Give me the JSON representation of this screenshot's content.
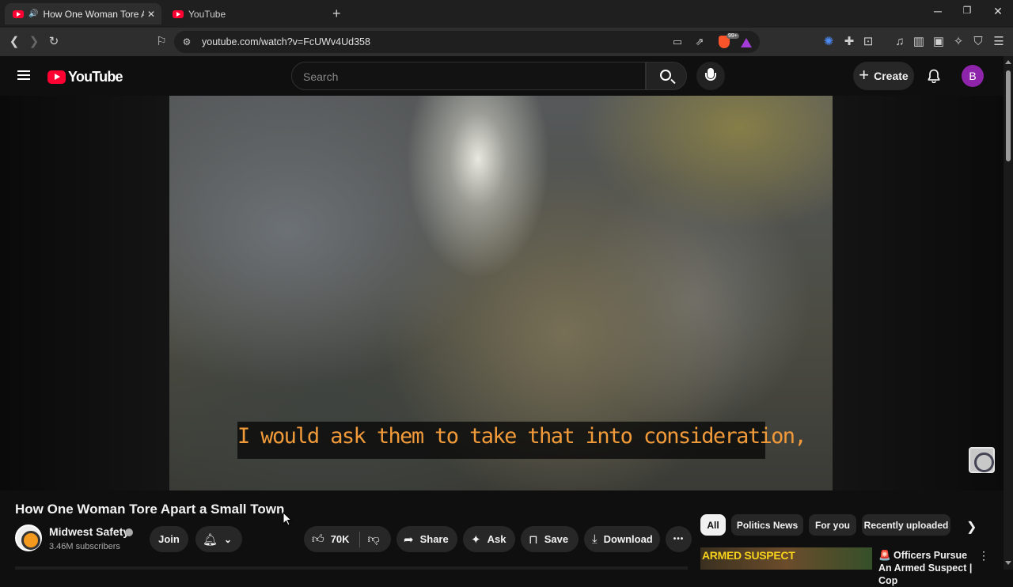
{
  "browser": {
    "tabs": [
      {
        "title": "How One Woman Tore Apart",
        "playing_audio": true,
        "active": true
      },
      {
        "title": "YouTube",
        "active": false
      }
    ],
    "new_tab": "+",
    "window": {
      "minimize": "─",
      "maximize": "❐",
      "close": "✕"
    },
    "url": "youtube.com/watch?v=FcUWv4Ud358"
  },
  "youtube": {
    "logo_text": "YouTube",
    "search_placeholder": "Search",
    "create_label": "Create",
    "avatar_letter": "B"
  },
  "player": {
    "caption": "I would ask them to take that into consideration,"
  },
  "video": {
    "title": "How One Woman Tore Apart a Small Town",
    "channel_name": "Midwest Safety",
    "subscribers": "3.46M subscribers",
    "join_label": "Join",
    "likes": "70K",
    "share_label": "Share",
    "ask_label": "Ask",
    "save_label": "Save",
    "download_label": "Download",
    "more": "•••"
  },
  "chips": [
    {
      "label": "All",
      "active": true
    },
    {
      "label": "Politics News",
      "active": false
    },
    {
      "label": "For you",
      "active": false
    },
    {
      "label": "Recently uploaded",
      "active": false
    }
  ],
  "recommendation": {
    "thumbnail_text": "ARMED SUSPECT",
    "title": "🚨 Officers Pursue An Armed Suspect | Cop"
  },
  "colors": {
    "brand_red": "#ff0033",
    "caption_orange": "#f09a3a",
    "avatar_purple": "#8e24aa"
  }
}
